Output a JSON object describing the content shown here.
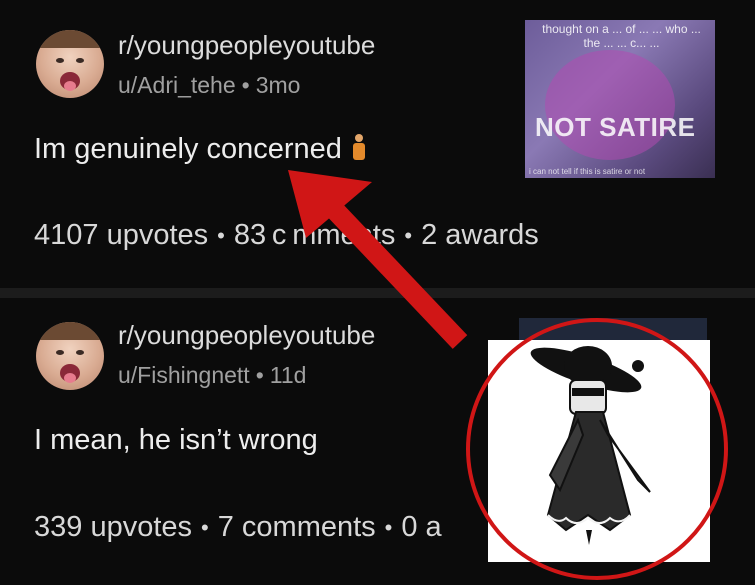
{
  "posts": [
    {
      "subreddit": "r/youngpeopleyoutube",
      "user": "u/Adri_tehe",
      "age": "3mo",
      "title": "Im genuinely concerned",
      "upvotes": "4107 upvotes",
      "comments": "83 c mments",
      "awards": "2 awards",
      "thumbnail": {
        "caption": "thought on a ... of ... ... who ... the ... ... c... ...",
        "overlay_text": "NOT SATIRE",
        "footer": "i can not tell if this is satire or not"
      }
    },
    {
      "subreddit": "r/youngpeopleyoutube",
      "user": "u/Fishingnett",
      "age": "11d",
      "title": "I mean, he isn’t wrong",
      "upvotes": "339 upvotes",
      "comments": "7 comments",
      "awards": "0 a"
    }
  ],
  "separator": "•",
  "meta_separator": "•",
  "colors": {
    "background": "#0b0b0b",
    "annotation_red": "#d01616",
    "divider": "#1c1c1c"
  },
  "annotations": {
    "arrow": "red-arrow-pointing-at-title",
    "circle": "red-circle-around-image"
  }
}
